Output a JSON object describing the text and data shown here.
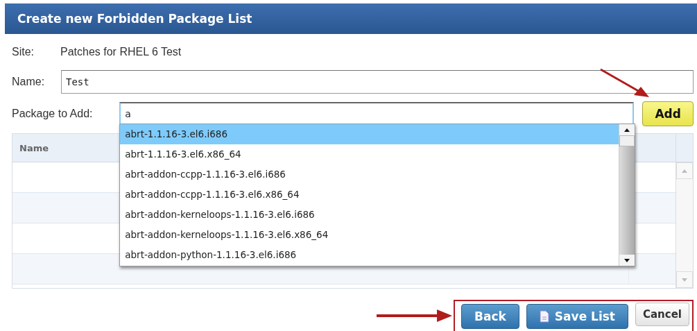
{
  "window": {
    "title": "Create new Forbidden Package List"
  },
  "site": {
    "label": "Site:",
    "value": "Patches for RHEL 6 Test"
  },
  "name_field": {
    "label": "Name:",
    "value": "Test"
  },
  "package_field": {
    "label": "Package to Add:",
    "value": "a"
  },
  "add_button": "Add",
  "suggestions": [
    {
      "label": "abrt-1.1.16-3.el6.i686",
      "selected": true
    },
    {
      "label": "abrt-1.1.16-3.el6.x86_64",
      "selected": false
    },
    {
      "label": "abrt-addon-ccpp-1.1.16-3.el6.i686",
      "selected": false
    },
    {
      "label": "abrt-addon-ccpp-1.1.16-3.el6.x86_64",
      "selected": false
    },
    {
      "label": "abrt-addon-kerneloops-1.1.16-3.el6.i686",
      "selected": false
    },
    {
      "label": "abrt-addon-kerneloops-1.1.16-3.el6.x86_64",
      "selected": false
    },
    {
      "label": "abrt-addon-python-1.1.16-3.el6.i686",
      "selected": false
    }
  ],
  "table": {
    "columns": [
      "Name"
    ]
  },
  "buttons": [
    {
      "label": "Back",
      "kind": "primary"
    },
    {
      "label": "Save List",
      "kind": "save"
    },
    {
      "label": "Cancel",
      "kind": "secondary"
    }
  ]
}
